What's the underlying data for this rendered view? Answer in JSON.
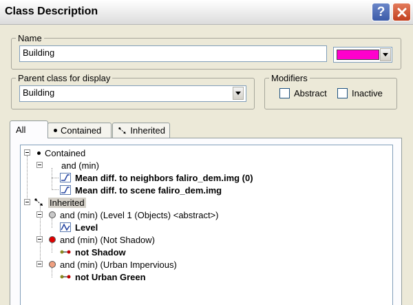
{
  "window": {
    "title": "Class Description",
    "help_icon": "help-icon",
    "close_icon": "close-icon"
  },
  "name_group": {
    "legend": "Name",
    "value": "Building",
    "color": "#ff00cc"
  },
  "parent_group": {
    "legend": "Parent class for display",
    "selected": "Building"
  },
  "modifiers": {
    "legend": "Modifiers",
    "abstract_label": "Abstract",
    "abstract_checked": false,
    "inactive_label": "Inactive",
    "inactive_checked": false
  },
  "tabs": [
    {
      "label": "All",
      "active": true
    },
    {
      "label": "Contained",
      "icon": "bullet-icon"
    },
    {
      "label": "Inherited",
      "icon": "inherit-arrow-icon"
    }
  ],
  "tree": {
    "contained": "Contained",
    "and_min": "and (min)",
    "feature1": "Mean diff. to neighbors faliro_dem.img  (0)",
    "feature2": "Mean diff. to scene faliro_dem.img",
    "inherited": "Inherited",
    "level1": "and (min) (Level 1 (Objects) <abstract>)",
    "level": "Level",
    "not_shadow_group": "and (min) (Not Shadow)",
    "not_shadow": "not Shadow",
    "urban_group": "and (min) (Urban Impervious)",
    "not_urban_green": "not Urban Green",
    "colors": {
      "level1": "#c8c8c8",
      "not_shadow": "#e00000",
      "urban": "#f0a080"
    }
  }
}
